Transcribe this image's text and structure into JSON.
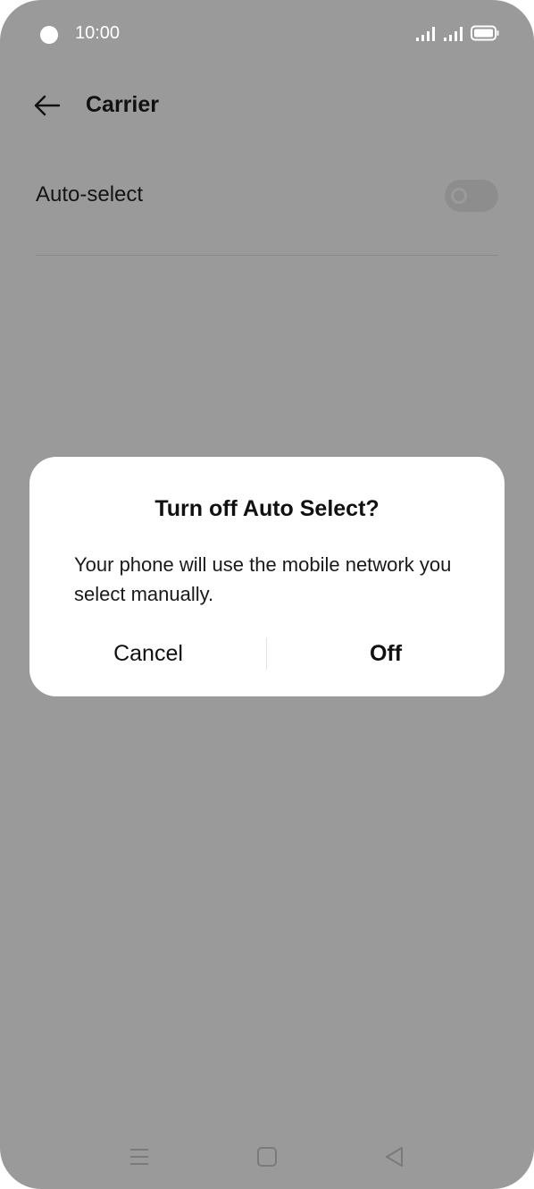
{
  "status_bar": {
    "time": "10:00",
    "icons": [
      "camera-dot",
      "signal-bars-sim1",
      "signal-bars-sim2",
      "battery-icon"
    ]
  },
  "header": {
    "back_icon": "arrow-left-icon",
    "title": "Carrier"
  },
  "settings": {
    "auto_select": {
      "label": "Auto-select",
      "toggle_state": "on"
    }
  },
  "dialog": {
    "title": "Turn off Auto Select?",
    "message": "Your phone will use the mobile network you select manually.",
    "cancel_label": "Cancel",
    "confirm_label": "Off"
  },
  "nav_bar": {
    "icons": [
      "menu-icon",
      "home-square-icon",
      "back-triangle-icon"
    ]
  },
  "colors": {
    "scrim_background": "#9a9a9a",
    "dialog_background": "#ffffff",
    "text_primary": "#111111"
  }
}
